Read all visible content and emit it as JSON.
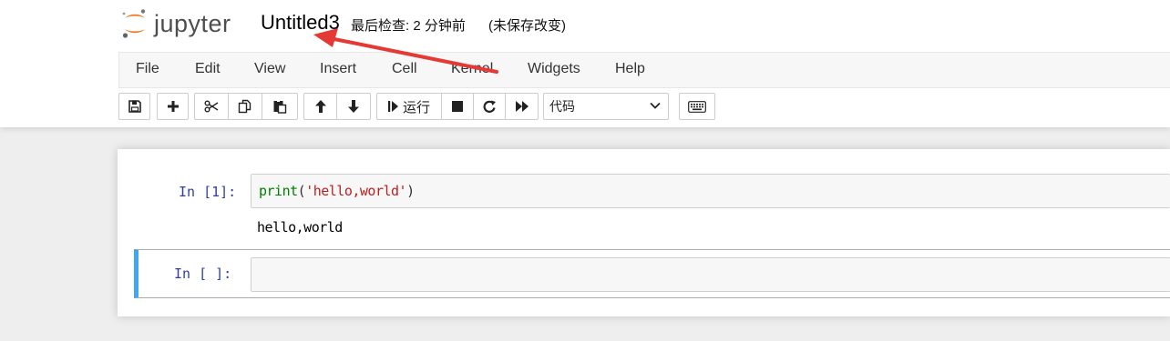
{
  "header": {
    "logo_text": "jupyter",
    "notebook_title": "Untitled3",
    "checkpoint_status": "最后检查: 2 分钟前",
    "autosave_status": "(未保存改变)"
  },
  "menubar": {
    "items": [
      "File",
      "Edit",
      "View",
      "Insert",
      "Cell",
      "Kernel",
      "Widgets",
      "Help"
    ]
  },
  "toolbar": {
    "run_label": "运行",
    "cell_type_selected": "代码",
    "buttons": [
      "save-icon",
      "plus-icon",
      "scissors-icon",
      "copy-icon",
      "paste-icon",
      "arrow-up-icon",
      "arrow-down-icon",
      "step-forward-icon",
      "stop-icon",
      "redo-icon",
      "fast-forward-icon",
      "keyboard-icon"
    ]
  },
  "cells": [
    {
      "prompt": "In  [1]:",
      "code": {
        "builtin": "print",
        "open": "(",
        "string": "'hello,world'",
        "close": ")"
      },
      "output": "hello,world"
    },
    {
      "prompt": "In  [  ]:",
      "code": ""
    }
  ],
  "colors": {
    "accent_selected_cell": "#42a5f5",
    "prompt_in": "#303f9f",
    "annotation_arrow": "#e53935",
    "logo_orange": "#f37726"
  }
}
